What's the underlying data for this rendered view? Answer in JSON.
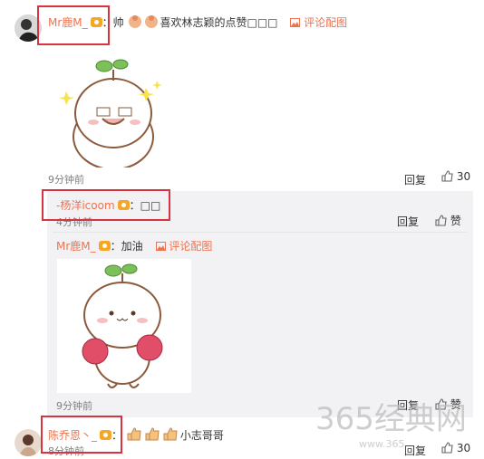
{
  "comment1": {
    "user": "Mr鹿M_",
    "text_prefix": "：帅",
    "text_suffix": "喜欢林志颖的点赞□□□",
    "image_link": "评论配图",
    "time": "9分钟前",
    "reply": "回复",
    "likes": "30"
  },
  "reply1": {
    "user": "-杨洋icoom",
    "text": "：□□",
    "time": "4分钟前",
    "reply": "回复",
    "like": "赞"
  },
  "reply2": {
    "user": "Mr鹿M_",
    "text": "：加油",
    "image_link": "评论配图",
    "time": "9分钟前",
    "reply": "回复",
    "like": "赞"
  },
  "comment2": {
    "user": "陈乔恩丶_",
    "text": "小志哥哥",
    "time": "8分钟前",
    "reply": "回复",
    "likes": "30"
  },
  "watermark": {
    "main": "365经典网",
    "sub": "www.365"
  },
  "colors": {
    "username": "#eb7350",
    "highlight": "#d9333f",
    "reply_bg": "#f2f2f5"
  }
}
